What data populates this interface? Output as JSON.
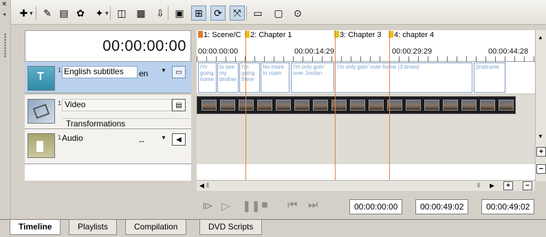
{
  "side": {
    "close": "×",
    "arrow": "◂"
  },
  "toolbar": {
    "buttons": [
      {
        "icon": "add-icon",
        "glyph": "✚",
        "dropdown": true,
        "pressed": false
      },
      {
        "icon": "subtitle-icon",
        "glyph": "✎",
        "pressed": false
      },
      {
        "icon": "folder-icon",
        "glyph": "▤",
        "pressed": false
      },
      {
        "icon": "chapter-icon",
        "glyph": "✿",
        "pressed": false
      },
      {
        "icon": "marker-icon",
        "glyph": "✦",
        "dropdown": true,
        "pressed": false
      },
      {
        "icon": "split-icon",
        "glyph": "◫",
        "pressed": false
      },
      {
        "icon": "snapshot-icon",
        "glyph": "▦",
        "pressed": false
      },
      {
        "icon": "import-icon",
        "glyph": "⇩",
        "pressed": false
      },
      {
        "icon": "export-icon",
        "glyph": "▣",
        "pressed": false
      },
      {
        "icon": "snap-icon",
        "glyph": "⊞",
        "pressed": true
      },
      {
        "icon": "ripple-icon",
        "glyph": "⟳",
        "pressed": true
      },
      {
        "icon": "scale-icon",
        "glyph": "⤧",
        "pressed": true
      },
      {
        "icon": "layout-icon",
        "glyph": "▭",
        "pressed": false
      },
      {
        "icon": "preview-icon",
        "glyph": "▢",
        "pressed": false
      },
      {
        "icon": "settings-icon",
        "glyph": "⊙",
        "pressed": false
      }
    ]
  },
  "timecode": "00:00:00:00",
  "tracks": {
    "subtitles": {
      "number": "1",
      "name": "English subtitles",
      "lang": "en"
    },
    "video": {
      "number": "1",
      "name": "Video",
      "transformations": "Transformations"
    },
    "audio": {
      "number": "1",
      "name": "Audio",
      "volume": "--"
    }
  },
  "ruler": {
    "markers": [
      {
        "label": "1: Scene/C",
        "color": "#e07a30"
      },
      {
        "label": "2: Chapter 1",
        "color": "#e8c020"
      },
      {
        "label": "3: Chapter 3",
        "color": "#e8c020"
      },
      {
        "label": "4: chapter 4",
        "color": "#e8c020"
      }
    ],
    "times": [
      "00:00:00:00",
      "00:00:14:29",
      "00:00:29:29",
      "00:00:44:28"
    ]
  },
  "captions": [
    "I'm going home",
    "to see my brother",
    "I'm going there",
    "No more to roam",
    "I'm only goin' over Jordan",
    "I'm only goin' over home (3 times)",
    "(Instrume"
  ],
  "transport": {
    "buttons": [
      {
        "icon": "play-loop-icon",
        "glyph": "⧐"
      },
      {
        "icon": "play-icon",
        "glyph": "▷"
      },
      {
        "icon": "pause-icon",
        "glyph": "❚❚"
      },
      {
        "icon": "stop-icon",
        "glyph": "■"
      },
      {
        "icon": "prev-icon",
        "glyph": "⏮"
      },
      {
        "icon": "next-icon",
        "glyph": "⏭"
      }
    ],
    "current": "00:00:00:00",
    "duration": "00:00:49:02",
    "total": "00:00:49:02"
  },
  "tabs": [
    "Timeline",
    "Playlists",
    "Compilation",
    "DVD Scripts"
  ],
  "active_tab": "Timeline"
}
